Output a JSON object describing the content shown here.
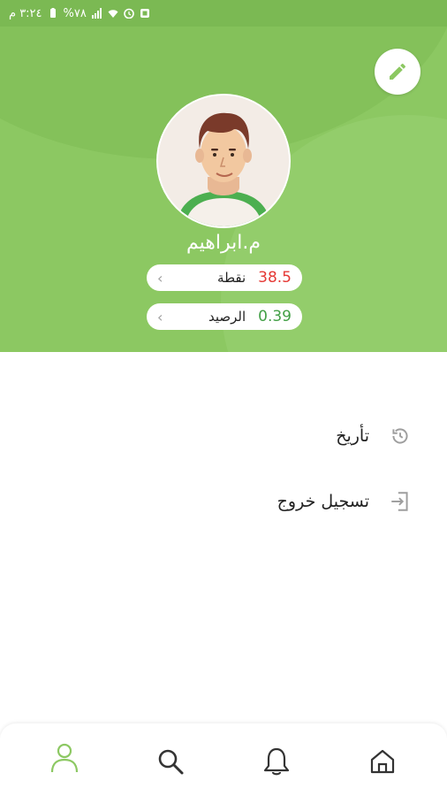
{
  "status_bar": {
    "time": "٣:٢٤ م",
    "battery": "%٧٨",
    "icons": [
      "battery-icon",
      "signal-icon",
      "wifi-icon",
      "alarm-icon",
      "notification-icon"
    ]
  },
  "profile": {
    "name": "م.ابراهيم",
    "points_label": "نقطة",
    "points_value": "38.5",
    "balance_label": "الرصيد",
    "balance_value": "0.39"
  },
  "menu": {
    "history_label": "تأريخ",
    "logout_label": "تسجيل خروج"
  },
  "bottom_nav": {
    "items": [
      "profile-icon",
      "search-icon",
      "bell-icon",
      "home-icon"
    ],
    "active": "profile-icon"
  },
  "colors": {
    "brand_green": "#8cc862",
    "points_red": "#e53935",
    "balance_green": "#43a047",
    "active_nav": "#8cc862",
    "inactive_nav": "#333333"
  }
}
